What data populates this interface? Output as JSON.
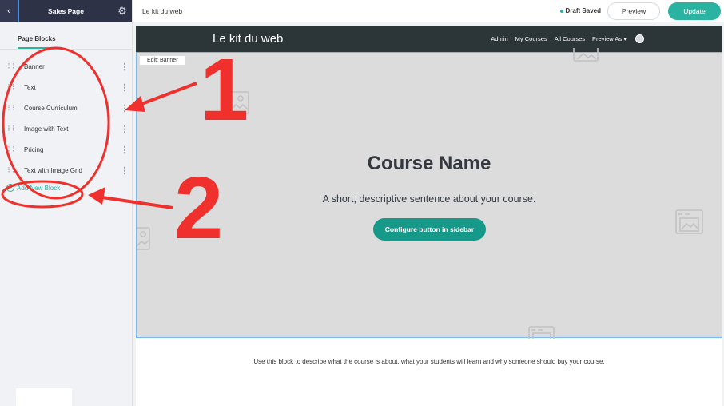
{
  "sidebar": {
    "title": "Sales Page",
    "tab": "Page Blocks",
    "items": [
      {
        "label": "Banner"
      },
      {
        "label": "Text"
      },
      {
        "label": "Course Curriculum"
      },
      {
        "label": "Image with Text"
      },
      {
        "label": "Pricing"
      },
      {
        "label": "Text with Image Grid"
      }
    ],
    "add_label": "Add New Block"
  },
  "topbar": {
    "title": "Le kit du web",
    "status": "Draft Saved",
    "preview_label": "Preview",
    "update_label": "Update"
  },
  "site": {
    "logo": "Le kit du web",
    "nav": [
      "Admin",
      "My Courses",
      "All Courses",
      "Preview As ▾"
    ]
  },
  "banner": {
    "edit_label": "Edit: Banner",
    "title": "Course Name",
    "subtitle": "A short, descriptive sentence about your course.",
    "button_label": "Configure button in sidebar"
  },
  "description": "Use this block to describe what the course is about, what your students will learn and why someone should buy your course.",
  "annotations": {
    "one": "1",
    "two": "2",
    "color": "#f0302c"
  },
  "colors": {
    "accent": "#2bb3a1",
    "sidebar_header": "#2d3247",
    "site_nav": "#2c3538",
    "banner_button": "#17998a"
  }
}
